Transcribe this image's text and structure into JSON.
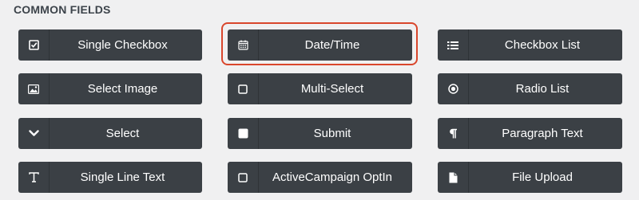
{
  "section": {
    "title": "COMMON FIELDS"
  },
  "fields": [
    {
      "label": "Single Checkbox",
      "icon": "checkbox-checked-icon"
    },
    {
      "label": "Date/Time",
      "icon": "calendar-icon",
      "highlighted": true
    },
    {
      "label": "Checkbox List",
      "icon": "list-icon"
    },
    {
      "label": "Select Image",
      "icon": "image-icon"
    },
    {
      "label": "Multi-Select",
      "icon": "square-outline-icon"
    },
    {
      "label": "Radio List",
      "icon": "radio-dot-icon"
    },
    {
      "label": "Select",
      "icon": "chevron-down-icon"
    },
    {
      "label": "Submit",
      "icon": "square-filled-icon"
    },
    {
      "label": "Paragraph Text",
      "icon": "pilcrow-icon"
    },
    {
      "label": "Single Line Text",
      "icon": "text-t-icon"
    },
    {
      "label": "ActiveCampaign OptIn",
      "icon": "square-outline-icon"
    },
    {
      "label": "File Upload",
      "icon": "file-icon"
    }
  ],
  "colors": {
    "button_bg": "#3b4045",
    "button_text": "#ffffff",
    "highlight": "#d9462c",
    "page_bg": "#f0f0f1"
  }
}
